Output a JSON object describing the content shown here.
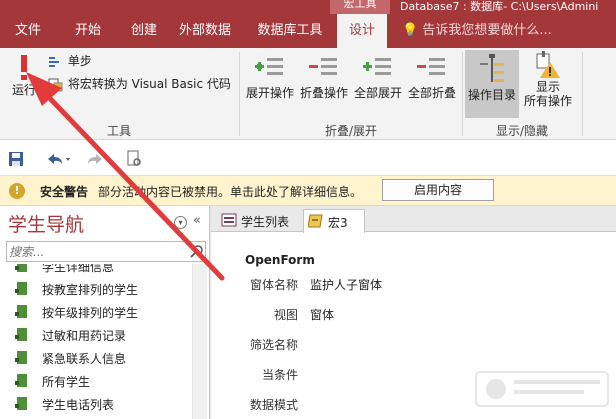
{
  "titlebar": {
    "context_tab": "宏工具",
    "db_name": "Database7 : 数据库- C:\\Users\\Admini"
  },
  "tabs": [
    {
      "label": "文件"
    },
    {
      "label": "开始"
    },
    {
      "label": "创建"
    },
    {
      "label": "外部数据"
    },
    {
      "label": "数据库工具"
    },
    {
      "label": "设计"
    }
  ],
  "tell_me": "告诉我您想要做什么...",
  "ribbon": {
    "run": "运行",
    "single_step": "单步",
    "convert_vba": "将宏转换为 Visual Basic 代码",
    "group_tools": "工具",
    "expand_action": "展开操作",
    "collapse_action": "折叠操作",
    "expand_all": "全部展开",
    "collapse_all": "全部折叠",
    "group_expand": "折叠/展开",
    "action_catalog": "操作目录",
    "show_all_line1": "显示",
    "show_all_line2": "所有操作",
    "group_show": "显示/隐藏"
  },
  "security": {
    "title": "安全警告",
    "message": "部分活动内容已被禁用。单击此处了解详细信息。",
    "enable_button": "启用内容"
  },
  "nav": {
    "title": "学生导航",
    "search_placeholder": "搜索...",
    "items": [
      {
        "label": "学生详细信息"
      },
      {
        "label": "按教室排列的学生"
      },
      {
        "label": "按年级排列的学生"
      },
      {
        "label": "过敏和用药记录"
      },
      {
        "label": "紧急联系人信息"
      },
      {
        "label": "所有学生"
      },
      {
        "label": "学生电话列表"
      }
    ]
  },
  "doc_tabs": [
    {
      "label": "学生列表"
    },
    {
      "label": "宏3"
    }
  ],
  "macro": {
    "action": "OpenForm",
    "fields": [
      {
        "key": "窗体名称",
        "value": "监护人子窗体"
      },
      {
        "key": "视图",
        "value": "窗体"
      },
      {
        "key": "筛选名称",
        "value": ""
      },
      {
        "key": "当条件",
        "value": ""
      },
      {
        "key": "数据模式",
        "value": ""
      }
    ]
  },
  "colors": {
    "accent": "#a4373a",
    "annotation_arrow": "#e23b3b",
    "warning_bar": "#fff4ce"
  }
}
